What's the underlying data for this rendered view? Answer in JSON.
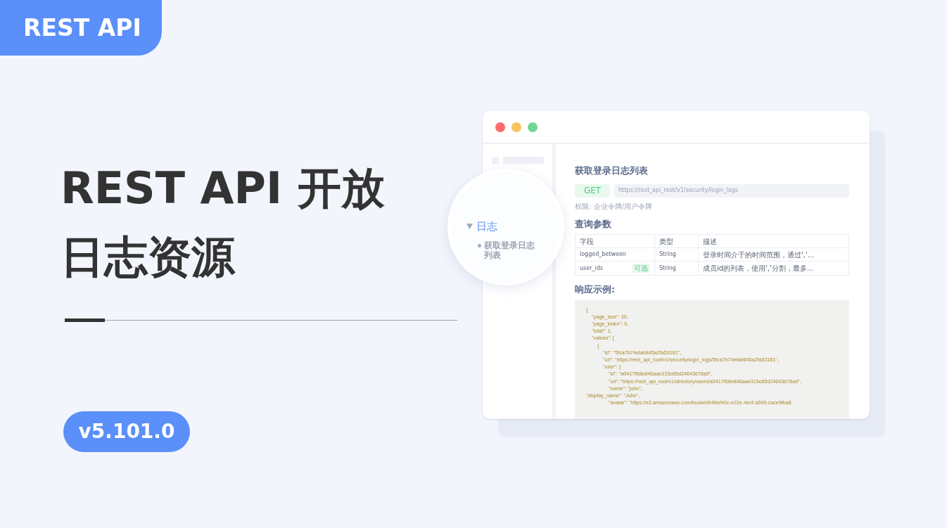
{
  "badge": "REST API",
  "headline": [
    "REST API 开放",
    "日志资源"
  ],
  "version": "v5.101.0",
  "window": {
    "sidebar": {
      "groups": [
        {
          "label": "日志",
          "expanded": true,
          "children": [
            {
              "label": "获取登录日志列表"
            }
          ]
        }
      ]
    },
    "doc": {
      "title": "获取登录日志列表",
      "method": "GET",
      "url": "https://rest_api_root/v1/security/login_logs",
      "permission": "权限: 企业令牌/用户令牌",
      "params_title": "查询参数",
      "table": {
        "columns": [
          "字段",
          "类型",
          "描述"
        ],
        "rows": [
          {
            "field": "logged_between",
            "tag": null,
            "type": "String",
            "description": "登录时间介于的时间范围，通过','..."
          },
          {
            "field": "user_ids",
            "tag": "可选",
            "type": "String",
            "description": "成员id的列表，使用','分割，最多..."
          }
        ]
      },
      "response_title": "响应示例:",
      "response_code": "{\n    \"page_size\": 30,\n    \"page_index\": 0,\n    \"total\": 1,\n    \"values\": [\n        {\n            \"id\": \"5fca7b74efab845a2fa53181\",\n            \"url\": \"https://rest_api_root/v1/security/login_logs/5fca7b74efab845a2fa53181\",\n            \"user\": {\n                \"id\": \"a0417f68e846aae315c85d24643678a9\",\n                \"url\": \"https://rest_api_root/v1/directory/users/a0417f68e846aae315c85d24643678a9\",\n                \"name\": \"john\",\n\"display_name\": \"John\",\n                \"avatar\": \"https://s3.amazonaws.com/bucket/b46ef40c-e22e-4ecf-a599-cace9fba8"
    }
  }
}
